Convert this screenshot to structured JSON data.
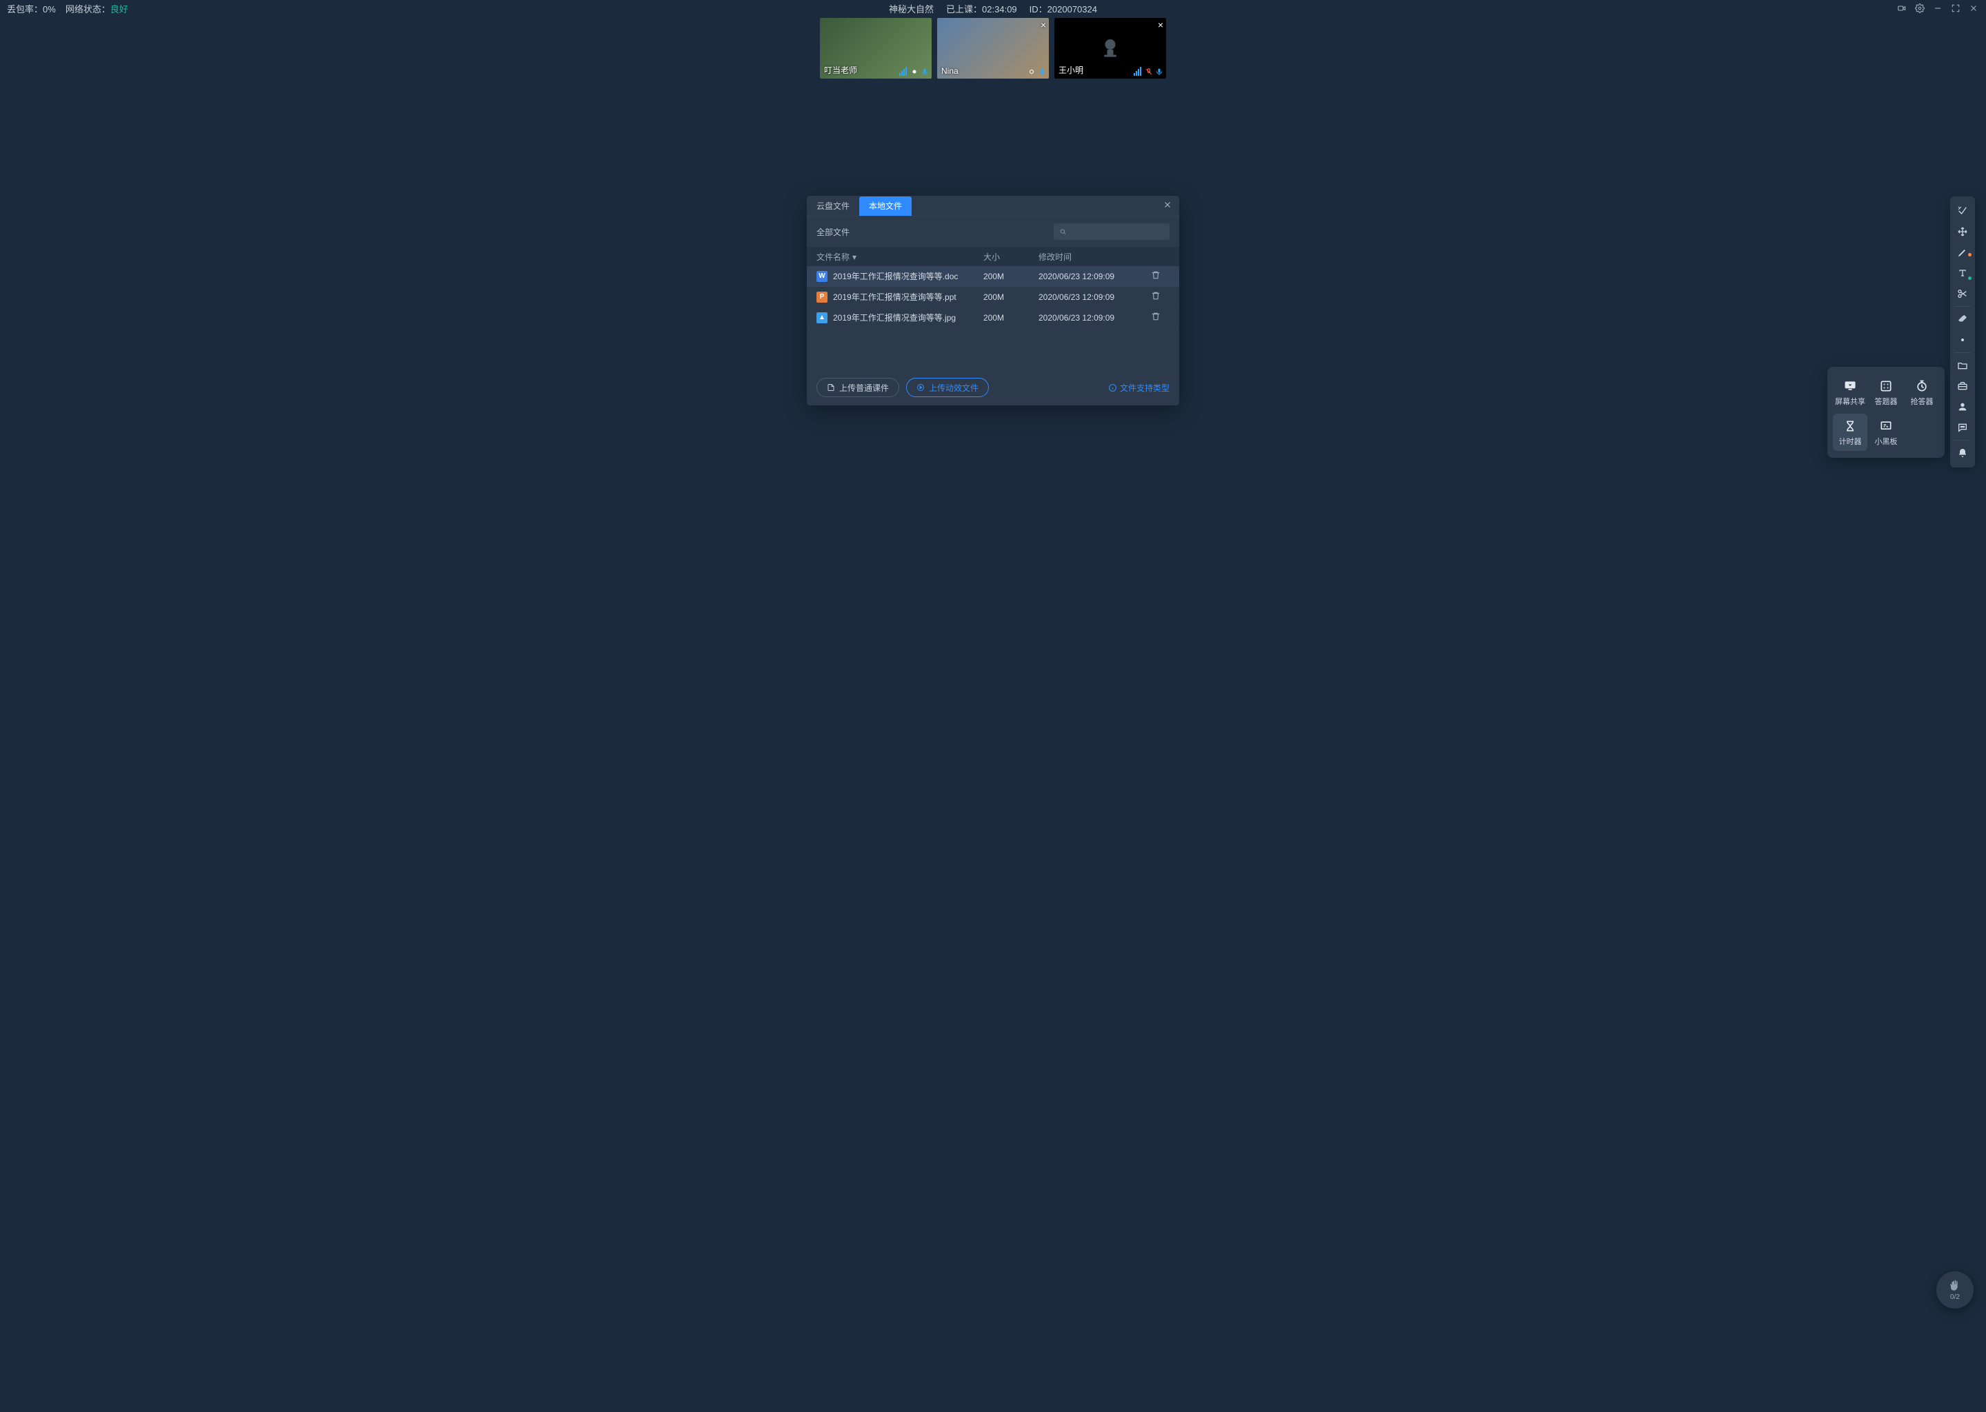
{
  "topbar": {
    "packet_loss_label": "丢包率：",
    "packet_loss_value": "0%",
    "network_label": "网络状态：",
    "network_value": "良好",
    "title": "神秘大自然",
    "elapsed_label": "已上课：",
    "elapsed_value": "02:34:09",
    "id_label": "ID：",
    "id_value": "2020070324"
  },
  "videos": [
    {
      "name": "叮当老师",
      "mic": "on",
      "has_close": false,
      "camera_off": false,
      "variant": "a"
    },
    {
      "name": "Nina",
      "mic": "on",
      "has_close": true,
      "camera_off": false,
      "variant": "b"
    },
    {
      "name": "王小明",
      "mic": "on_muted_cam",
      "has_close": true,
      "camera_off": true,
      "variant": "off"
    }
  ],
  "dialog": {
    "tabs": {
      "cloud": "云盘文件",
      "local": "本地文件"
    },
    "section_label": "全部文件",
    "columns": {
      "name": "文件名称",
      "size": "大小",
      "mtime": "修改时间"
    },
    "files": [
      {
        "icon": "doc",
        "name": "2019年工作汇报情况查询等等.doc",
        "size": "200M",
        "mtime": "2020/06/23 12:09:09"
      },
      {
        "icon": "ppt",
        "name": "2019年工作汇报情况查询等等.ppt",
        "size": "200M",
        "mtime": "2020/06/23 12:09:09"
      },
      {
        "icon": "img",
        "name": "2019年工作汇报情况查询等等.jpg",
        "size": "200M",
        "mtime": "2020/06/23 12:09:09"
      }
    ],
    "btn_upload_plain": "上传普通课件",
    "btn_upload_anim": "上传动效文件",
    "link_supported": "文件支持类型"
  },
  "tools_panel": {
    "screen_share": "屏幕共享",
    "answer": "答题器",
    "race": "抢答器",
    "timer": "计时器",
    "blackboard": "小黑板"
  },
  "file_icon_letters": {
    "doc": "W",
    "ppt": "P",
    "img": "▲"
  },
  "hand": {
    "count": "0/2"
  }
}
